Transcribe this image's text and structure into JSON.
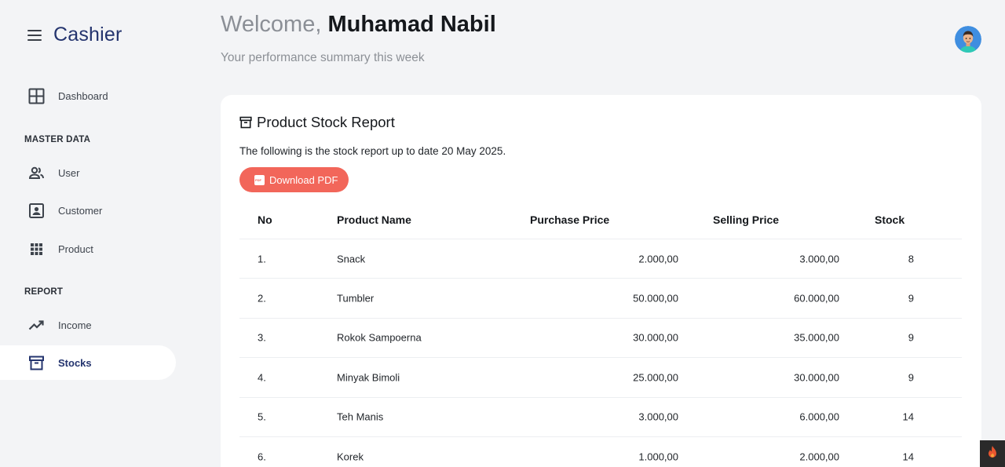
{
  "app": {
    "name": "Cashier"
  },
  "sidebar": {
    "dashboard": {
      "label": "Dashboard",
      "icon": "grid-icon"
    },
    "sections": {
      "master": "MASTER DATA",
      "report": "REPORT"
    },
    "master_items": [
      {
        "label": "User",
        "icon": "users-icon"
      },
      {
        "label": "Customer",
        "icon": "contact-card-icon"
      },
      {
        "label": "Product",
        "icon": "apps-grid-icon"
      }
    ],
    "report_items": [
      {
        "label": "Income",
        "icon": "trending-up-icon"
      },
      {
        "label": "Stocks",
        "icon": "archive-box-icon",
        "active": true
      }
    ]
  },
  "header": {
    "welcome_prefix": "Welcome, ",
    "user_name": "Muhamad Nabil",
    "subtitle": "Your performance summary this week"
  },
  "card": {
    "title": "Product Stock Report",
    "description": "The following is the stock report up to date 20 May 2025.",
    "download_label": "Download PDF"
  },
  "table": {
    "headers": {
      "no": "No",
      "name": "Product Name",
      "purchase": "Purchase Price",
      "selling": "Selling Price",
      "stock": "Stock"
    },
    "rows": [
      {
        "no": "1.",
        "name": "Snack",
        "purchase": "2.000,00",
        "selling": "3.000,00",
        "stock": "8"
      },
      {
        "no": "2.",
        "name": "Tumbler",
        "purchase": "50.000,00",
        "selling": "60.000,00",
        "stock": "9"
      },
      {
        "no": "3.",
        "name": "Rokok Sampoerna",
        "purchase": "30.000,00",
        "selling": "35.000,00",
        "stock": "9"
      },
      {
        "no": "4.",
        "name": "Minyak Bimoli",
        "purchase": "25.000,00",
        "selling": "30.000,00",
        "stock": "9"
      },
      {
        "no": "5.",
        "name": "Teh Manis",
        "purchase": "3.000,00",
        "selling": "6.000,00",
        "stock": "14"
      },
      {
        "no": "6.",
        "name": "Korek",
        "purchase": "1.000,00",
        "selling": "2.000,00",
        "stock": "14"
      }
    ]
  },
  "colors": {
    "brand": "#24346e",
    "accent_button": "#f2665a",
    "background": "#f3f4f6"
  }
}
